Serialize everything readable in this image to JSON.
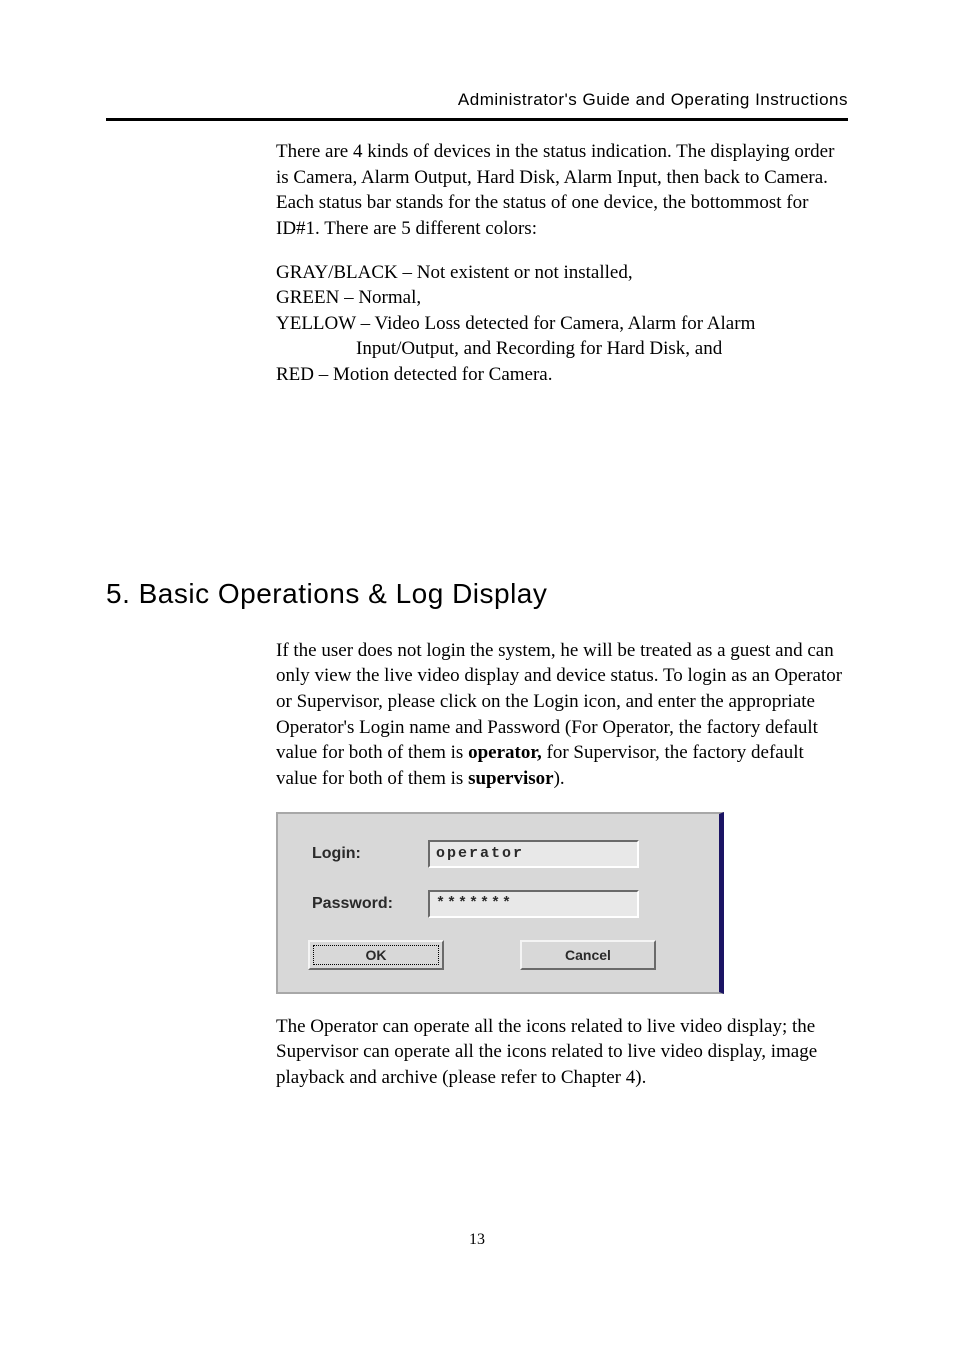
{
  "header": {
    "title": "Administrator's Guide and Operating Instructions"
  },
  "body": {
    "intro_para": "There are 4 kinds of devices in the status indication.    The displaying order is Camera, Alarm Output, Hard Disk, Alarm Input, then back to Camera. Each status bar stands for the status of one device, the bottommost for ID#1.    There are 5 different colors:",
    "color_lines": {
      "gray": "GRAY/BLACK – Not existent or not installed,",
      "green": "GREEN – Normal,",
      "yellow": "YELLOW – Video Loss detected for Camera, Alarm for Alarm",
      "yellow_sub": "Input/Output, and Recording for Hard Disk, and",
      "red": "RED – Motion detected for Camera."
    },
    "section_heading": "5. Basic Operations & Log Display",
    "login_para_pre": "If the user does not login the system, he will be treated as a guest and can only view the live video display and device status.    To login as an Operator or Supervisor, please click on the Login icon, and enter the appropriate Operator's Login name and Password (For Operator, the factory default value for both of them is ",
    "login_para_bold1": "operator,",
    "login_para_mid": " for Supervisor, the factory default value for both of them is ",
    "login_para_bold2": "supervisor",
    "login_para_post": ").",
    "after_dialog_para": "The Operator can operate all the icons related to live video display; the Supervisor can operate all the icons related to live video display, image playback and archive (please refer to Chapter 4)."
  },
  "dialog": {
    "login_label": "Login:",
    "login_value": "operator",
    "password_label": "Password:",
    "password_value": "*******",
    "ok_label": "OK",
    "cancel_label": "Cancel"
  },
  "footer": {
    "page_number": "13"
  }
}
